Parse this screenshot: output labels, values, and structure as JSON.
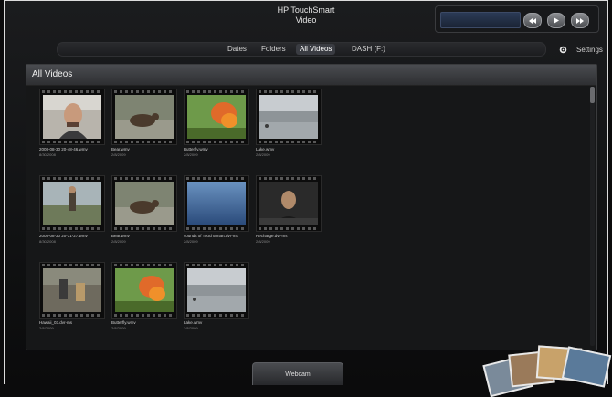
{
  "header": {
    "app_title": "HP TouchSmart",
    "section_title": "Video"
  },
  "icons": {
    "home": "home-icon",
    "rewind": "rewind-icon",
    "play": "play-icon",
    "forward": "forward-icon",
    "settings": "gear-icon"
  },
  "tabs": [
    {
      "label": "Dates",
      "active": false
    },
    {
      "label": "Folders",
      "active": false
    },
    {
      "label": "All Videos",
      "active": true
    },
    {
      "label": "DASH (F:)",
      "active": false
    }
  ],
  "settings_label": "Settings",
  "panel": {
    "title": "All Videos"
  },
  "videos": [
    {
      "name": "2008-08-30 20-48-46.wmv",
      "date": "8/30/2008"
    },
    {
      "name": "Bear.wmv",
      "date": "2/8/2009"
    },
    {
      "name": "Butterfly.wmv",
      "date": "2/8/2009"
    },
    {
      "name": "Lake.wmv",
      "date": "2/8/2009"
    },
    {
      "name": "2008-08-30 20-31-27.wmv",
      "date": "8/30/2008"
    },
    {
      "name": "Bear.wmv",
      "date": "2/8/2009"
    },
    {
      "name": "sounds of TouchSmart.dvr-ms",
      "date": "2/8/2009"
    },
    {
      "name": "Recharge.dvr-ms",
      "date": "2/8/2009"
    },
    {
      "name": "Hawaii_03.dvr-ms",
      "date": "2/8/2009"
    },
    {
      "name": "Butterfly.wmv",
      "date": "2/8/2009"
    },
    {
      "name": "Lake.wmv",
      "date": "2/8/2009"
    }
  ],
  "bottom_button": {
    "label": "Webcam"
  },
  "colors": {
    "background": "#0b0b0c",
    "panel": "#161718",
    "active_tab": "#3a3c42"
  }
}
